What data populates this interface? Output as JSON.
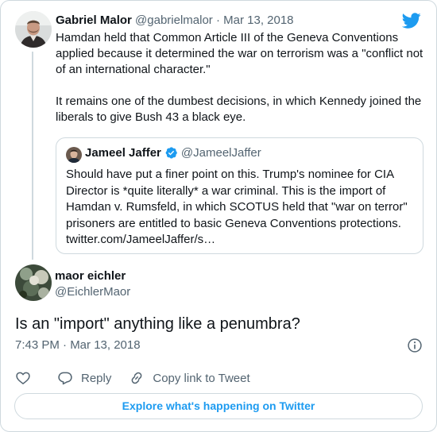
{
  "colors": {
    "accent": "#1d9bf0",
    "muted": "#536471",
    "border": "#cfd9de"
  },
  "icons": {
    "logo": "twitter-bird-icon",
    "verified": "verified-badge-icon",
    "info": "info-icon",
    "like": "heart-icon",
    "reply": "reply-icon",
    "copy_link": "link-icon"
  },
  "parent_tweet": {
    "name": "Gabriel Malor",
    "handle": "@gabrielmalor",
    "separator": "·",
    "date": "Mar 13, 2018",
    "text": "Hamdan held that Common Article III of the Geneva Conventions applied because it determined the war on terrorism was a \"conflict not of an international character.\"\n\nIt remains one of the dumbest decisions, in which Kennedy joined the liberals to give Bush 43 a black eye.",
    "quoted": {
      "name": "Jameel Jaffer",
      "handle": "@JameelJaffer",
      "text": "Should have put a finer point on this. Trump's nominee for CIA Director is *quite literally* a war criminal. This is the import of Hamdan v. Rumsfeld, in which SCOTUS held that \"war on terror\" prisoners are entitled to basic Geneva Conventions protections. twitter.com/JameelJaffer/s…"
    }
  },
  "main_tweet": {
    "name": "maor eichler",
    "handle": "@EichlerMaor",
    "text": "Is an \"import\" anything like a penumbra?",
    "timestamp": "7:43 PM · Mar 13, 2018"
  },
  "actions": {
    "reply_label": "Reply",
    "copy_link_label": "Copy link to Tweet"
  },
  "explore_label": "Explore what's happening on Twitter"
}
